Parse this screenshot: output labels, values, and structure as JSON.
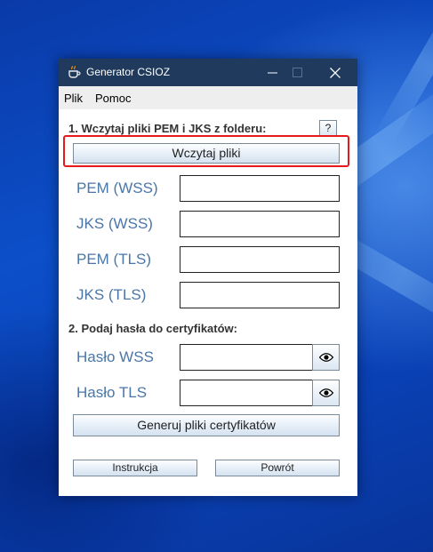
{
  "window": {
    "title": "Generator CSIOZ"
  },
  "menu": {
    "file": "Plik",
    "help": "Pomoc"
  },
  "section1": {
    "title": "1. Wczytaj pliki PEM i JKS z folderu:",
    "help_label": "?",
    "load_button": "Wczytaj pliki"
  },
  "fields": {
    "pem_wss": "PEM (WSS)",
    "jks_wss": "JKS (WSS)",
    "pem_tls": "PEM (TLS)",
    "jks_tls": "JKS (TLS)"
  },
  "section2": {
    "title": "2. Podaj hasła do certyfikatów:",
    "wss_password": "Hasło WSS",
    "tls_password": "Hasło TLS",
    "generate_button": "Generuj pliki certyfikatów"
  },
  "footer": {
    "instructions_button": "Instrukcja",
    "back_button": "Powrót"
  },
  "icons": {
    "app": "java-cup-icon",
    "reveal": "eye-icon"
  },
  "colors": {
    "highlight": "#e51a1a",
    "titlebar": "#1f3a5c",
    "label": "#4a76a8",
    "desktop": "#0c4fc9"
  }
}
